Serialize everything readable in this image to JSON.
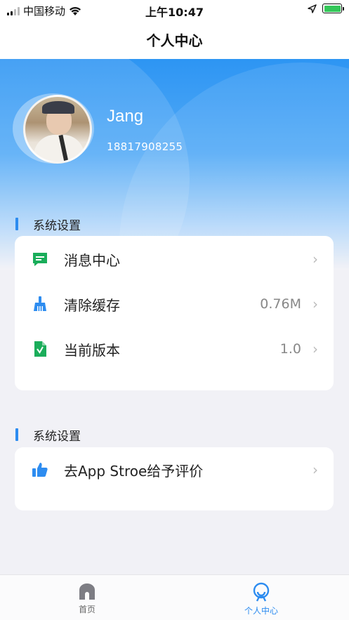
{
  "status_bar": {
    "carrier": "中国移动",
    "time": "上午10:47"
  },
  "nav": {
    "title": "个人中心"
  },
  "profile": {
    "name": "Jang",
    "phone": "18817908255"
  },
  "section1": {
    "title": "系统设置",
    "items": [
      {
        "label": "消息中心",
        "value": "",
        "icon": "message-icon"
      },
      {
        "label": "清除缓存",
        "value": "0.76M",
        "icon": "broom-icon"
      },
      {
        "label": "当前版本",
        "value": "1.0",
        "icon": "document-icon"
      }
    ]
  },
  "section2": {
    "title": "系统设置",
    "items": [
      {
        "label": "去App Stroe给予评价",
        "value": "",
        "icon": "thumbs-up-icon"
      }
    ]
  },
  "tabbar": {
    "items": [
      {
        "label": "首页",
        "icon": "home-icon"
      },
      {
        "label": "个人中心",
        "icon": "person-icon"
      }
    ]
  },
  "colors": {
    "accent": "#2d8cf0",
    "header_top": "#2d95f3",
    "icon_green": "#1aad5a",
    "icon_blue": "#2d8cf0"
  }
}
